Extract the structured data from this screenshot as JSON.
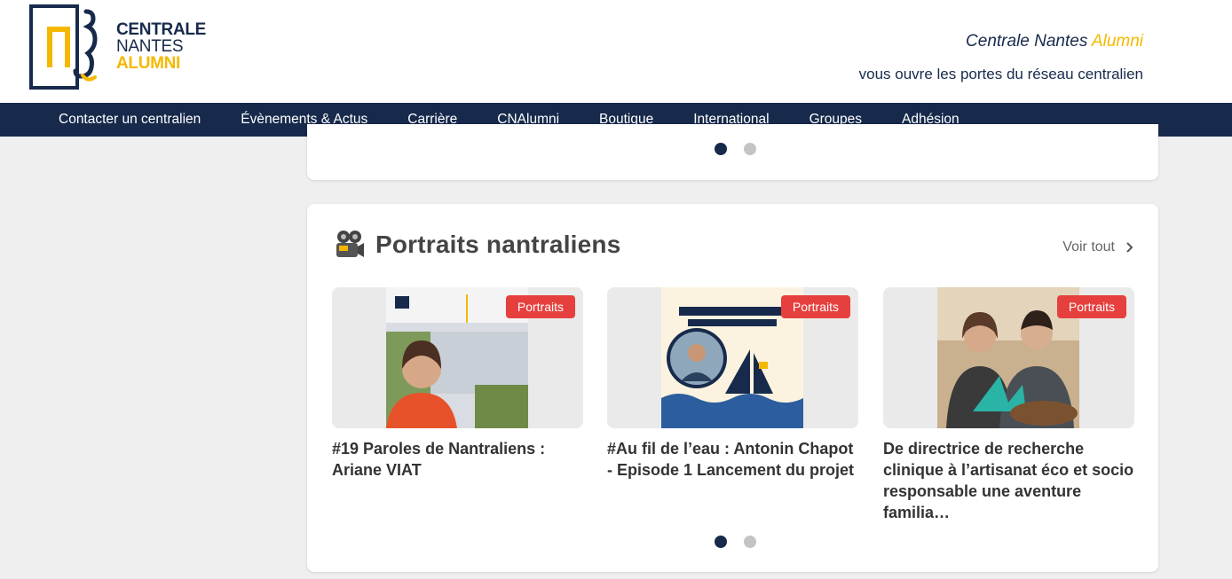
{
  "header": {
    "logo": {
      "line1": "CENTRALE",
      "line2": "NANTES",
      "line3": "ALUMNI"
    },
    "tagline": {
      "title_main": "Centrale Nantes",
      "title_accent": "Alumni",
      "subtitle": "vous ouvre les portes du réseau centralien"
    }
  },
  "nav": {
    "items": [
      "Contacter un centralien",
      "Évènements & Actus",
      "Carrière",
      "CNAlumni",
      "Boutique",
      "International",
      "Groupes",
      "Adhésion"
    ]
  },
  "section": {
    "icon": "video-camera-icon",
    "title": "Portraits nantraliens",
    "see_all": "Voir tout",
    "items": [
      {
        "badge": "Portraits",
        "title": "#19 Paroles de Nantraliens : Ariane VIAT"
      },
      {
        "badge": "Portraits",
        "title": "#Au fil de l’eau : Antonin Chapot - Episode 1 Lancement du projet"
      },
      {
        "badge": "Portraits",
        "title": "De directrice de recherche clinique à l’artisanat éco et socio responsable une aventure familia…"
      }
    ]
  },
  "colors": {
    "navy": "#172a4c",
    "gold": "#f5b800",
    "badge_red": "#e5403e"
  }
}
